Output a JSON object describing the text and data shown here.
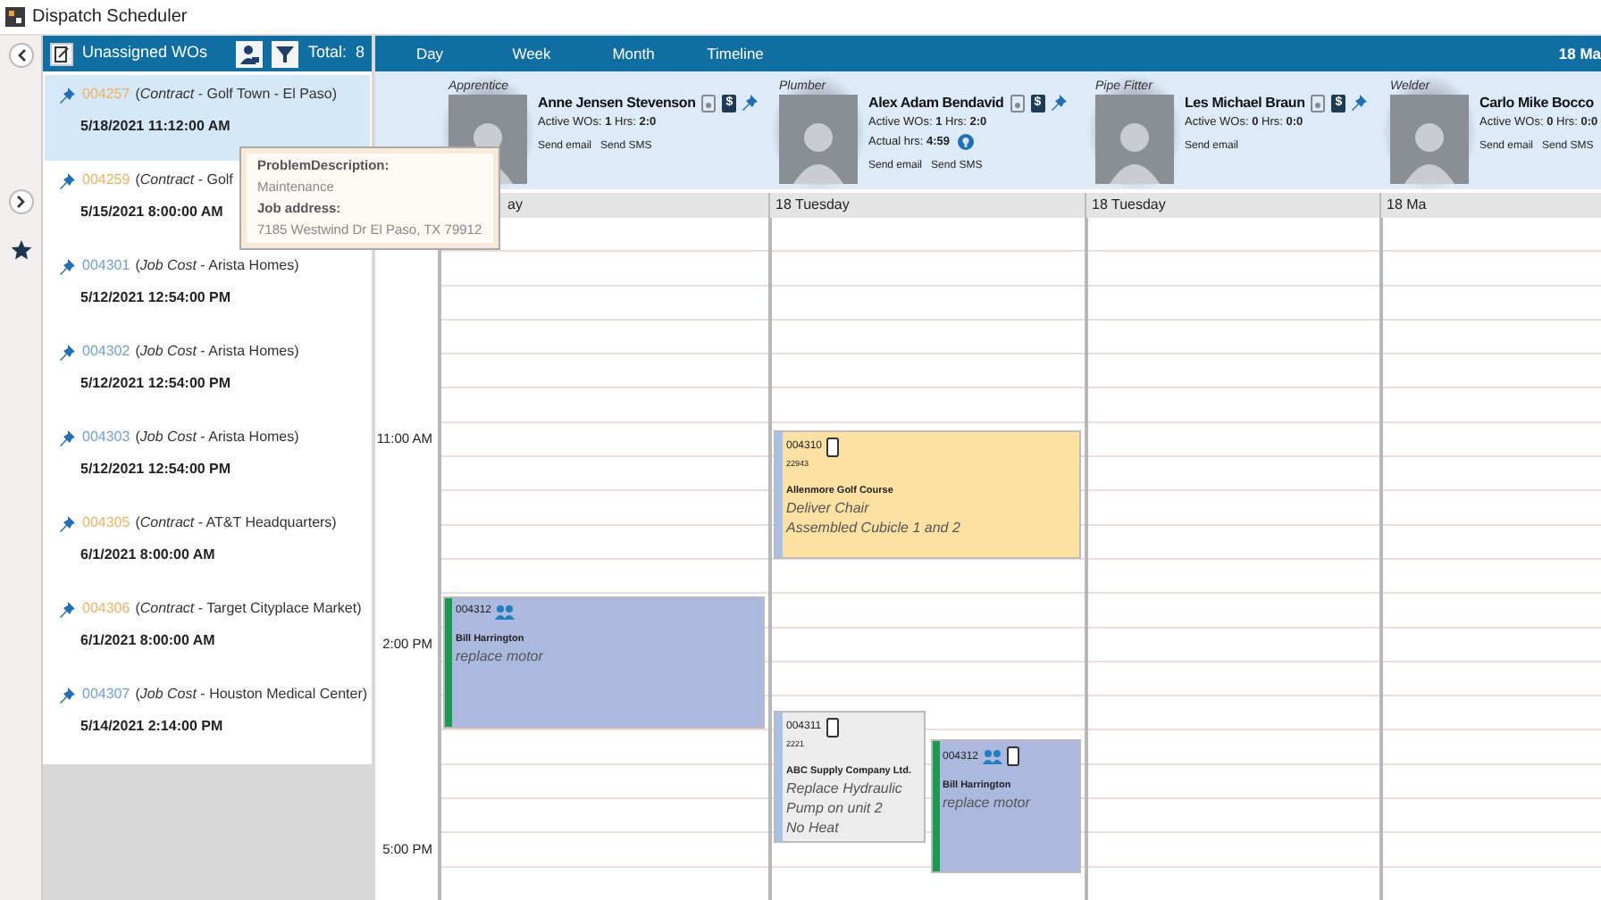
{
  "window": {
    "title": "Dispatch Scheduler"
  },
  "unassigned": {
    "title": "Unassigned WOs",
    "total_label": "Total:",
    "total": "8",
    "items": [
      {
        "number": "004257",
        "kind": "contract",
        "detail": "(*Contract* - Golf Town - El Paso)",
        "date": "5/18/2021 11:12:00 AM",
        "selected": true
      },
      {
        "number": "004259",
        "kind": "contract",
        "detail": "(*Contract* - Golf",
        "date": "5/15/2021 8:00:00 AM",
        "selected": false
      },
      {
        "number": "004301",
        "kind": "jobcost",
        "detail": "(*Job Cost* - Arista Homes)",
        "date": "5/12/2021 12:54:00 PM",
        "selected": false
      },
      {
        "number": "004302",
        "kind": "jobcost",
        "detail": "(*Job Cost* - Arista Homes)",
        "date": "5/12/2021 12:54:00 PM",
        "selected": false
      },
      {
        "number": "004303",
        "kind": "jobcost",
        "detail": "(*Job Cost* - Arista Homes)",
        "date": "5/12/2021 12:54:00 PM",
        "selected": false
      },
      {
        "number": "004305",
        "kind": "contract",
        "detail": "(*Contract* - AT&T Headquarters)",
        "date": "6/1/2021 8:00:00 AM",
        "selected": false
      },
      {
        "number": "004306",
        "kind": "contract",
        "detail": "(*Contract* - Target Cityplace Market)",
        "date": "6/1/2021 8:00:00 AM",
        "selected": false
      },
      {
        "number": "004307",
        "kind": "jobcost",
        "detail": "(*Job Cost* - Houston Medical Center)",
        "date": "5/14/2021 2:14:00 PM",
        "selected": false
      }
    ]
  },
  "tooltip": {
    "lines": [
      {
        "kind": "label",
        "text": "ProblemDescription:"
      },
      {
        "kind": "value",
        "text": "Maintenance"
      },
      {
        "kind": "label",
        "text": "Job address:"
      },
      {
        "kind": "value",
        "text": "7185 Westwind Dr El Paso, TX 79912"
      }
    ]
  },
  "views": [
    {
      "label": "Day",
      "selected": false
    },
    {
      "label": "Week",
      "selected": false
    },
    {
      "label": "Month",
      "selected": false
    },
    {
      "label": "Timeline",
      "selected": false
    }
  ],
  "date_header": "18 Ma",
  "technicians": [
    {
      "role": "Apprentice",
      "name": "Anne Jensen Stevenson",
      "badge": "$",
      "active": "Active WOs: **1** Hrs: **2:0**",
      "links": [
        "Send email",
        "Send SMS"
      ]
    },
    {
      "role": "Plumber",
      "name": "Alex Adam Bendavid",
      "badge": "$",
      "active": "Active WOs: **1** Hrs: **2:0**",
      "actual": "Actual hrs: **4:59**",
      "links": [
        "Send email",
        "Send SMS"
      ]
    },
    {
      "role": "Pipe Fitter",
      "name": "Les Michael Braun",
      "badge": "$",
      "active": "Active WOs: **0** Hrs: **0:0**",
      "links": [
        "Send email"
      ]
    },
    {
      "role": "Welder",
      "name": "Carlo Mike Bocco",
      "active": "Active WOs: **0** Hrs: **0:0**",
      "links": [
        "Send email",
        "Send SMS"
      ]
    }
  ],
  "time_labels": [
    "11:00 AM",
    "2:00 PM",
    "5:00 PM"
  ],
  "days": [
    {
      "header": "ay",
      "events": [
        {
          "number": "004312",
          "kind": "crew",
          "team": true,
          "mobile": false,
          "customer": "Bill Harrington",
          "description": [
            "replace motor"
          ],
          "color": "#1a9a50"
        }
      ]
    },
    {
      "header": "18 Tuesday",
      "events": [
        {
          "number": "004310",
          "kind": "delivery",
          "team": false,
          "mobile": true,
          "code": "22943",
          "customer": "Allenmore Golf Course",
          "description": [
            "Deliver Chair",
            "Assembled Cubicle 1 and 2"
          ],
          "color": "#a9c1e6"
        },
        {
          "number": "004311",
          "kind": "repair",
          "team": false,
          "mobile": true,
          "code": "2221",
          "customer": "ABC Supply Company Ltd.",
          "description": [
            "Replace Hydraulic",
            "Pump on unit 2",
            "No Heat"
          ],
          "color": "#a9c1e6"
        },
        {
          "number": "004312",
          "kind": "crew",
          "team": true,
          "mobile": true,
          "customer": "Bill Harrington",
          "description": [
            "replace motor"
          ],
          "color": "#1a9a50"
        }
      ]
    },
    {
      "header": "18 Tuesday"
    },
    {
      "header": "18 Ma"
    }
  ]
}
